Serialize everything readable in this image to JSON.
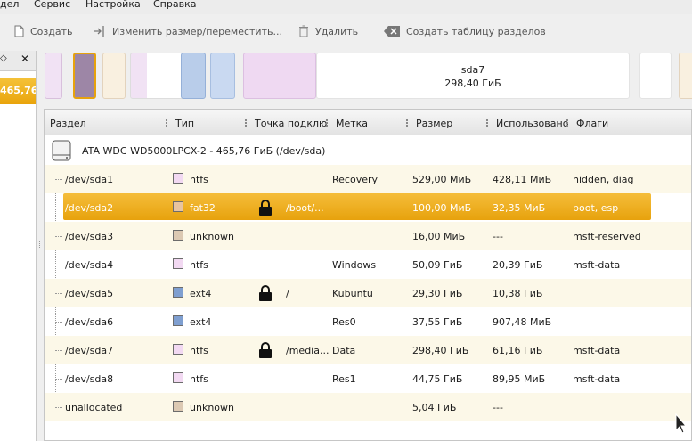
{
  "menu": [
    "дел",
    "Сервис",
    "Настройка",
    "Справка"
  ],
  "toolbar": {
    "create": "Создать",
    "resize": "Изменить размер/переместить...",
    "delete": "Удалить",
    "new_table": "Создать таблицу разделов"
  },
  "left_panel": {
    "device_size": "465,76..."
  },
  "diskmap": {
    "selected_name": "sda7",
    "selected_size": "298,40 ГиБ"
  },
  "table": {
    "columns": [
      "Раздел",
      "Тип",
      "Точка подклю",
      "Метка",
      "Размер",
      "Использовано",
      "Флаги"
    ],
    "disk_label": "ATA WDC WD5000LPCX-2 - 465,76 ГиБ (/dev/sda)",
    "rows": [
      {
        "partition": "/dev/sda1",
        "type": "ntfs",
        "type_color": "#f2d9f2",
        "locked": false,
        "mount": "",
        "label": "Recovery",
        "size": "529,00 МиБ",
        "used": "428,11 МиБ",
        "flags": "hidden, diag"
      },
      {
        "partition": "/dev/sda2",
        "type": "fat32",
        "type_color": "#e8c4a0",
        "locked": true,
        "mount": "/boot/...",
        "label": "",
        "size": "100,00 МиБ",
        "used": "32,35 МиБ",
        "flags": "boot, esp"
      },
      {
        "partition": "/dev/sda3",
        "type": "unknown",
        "type_color": "#dcc9b3",
        "locked": false,
        "mount": "",
        "label": "",
        "size": "16,00 МиБ",
        "used": "---",
        "flags": "msft-reserved"
      },
      {
        "partition": "/dev/sda4",
        "type": "ntfs",
        "type_color": "#f2d9f2",
        "locked": false,
        "mount": "",
        "label": "Windows",
        "size": "50,09 ГиБ",
        "used": "20,39 ГиБ",
        "flags": "msft-data"
      },
      {
        "partition": "/dev/sda5",
        "type": "ext4",
        "type_color": "#7f9fd0",
        "locked": true,
        "mount": "/",
        "label": "Kubuntu",
        "size": "29,30 ГиБ",
        "used": "10,38 ГиБ",
        "flags": ""
      },
      {
        "partition": "/dev/sda6",
        "type": "ext4",
        "type_color": "#7f9fd0",
        "locked": false,
        "mount": "",
        "label": "Res0",
        "size": "37,55 ГиБ",
        "used": "907,48 МиБ",
        "flags": ""
      },
      {
        "partition": "/dev/sda7",
        "type": "ntfs",
        "type_color": "#f2d9f2",
        "locked": true,
        "mount": "/media...",
        "label": "Data",
        "size": "298,40 ГиБ",
        "used": "61,16 ГиБ",
        "flags": "msft-data"
      },
      {
        "partition": "/dev/sda8",
        "type": "ntfs",
        "type_color": "#f2d9f2",
        "locked": false,
        "mount": "",
        "label": "Res1",
        "size": "44,75 ГиБ",
        "used": "89,95 МиБ",
        "flags": "msft-data"
      },
      {
        "partition": "unallocated",
        "type": "unknown",
        "type_color": "#dcc9b3",
        "locked": false,
        "mount": "",
        "label": "",
        "size": "5,04 ГиБ",
        "used": "---",
        "flags": ""
      }
    ]
  }
}
